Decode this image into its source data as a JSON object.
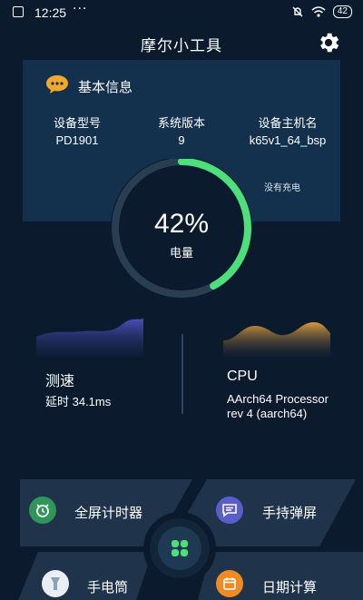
{
  "status_bar": {
    "time": "12:25",
    "dots": "···",
    "battery": "42"
  },
  "app": {
    "title": "摩尔小工具"
  },
  "info_card": {
    "title": "基本信息",
    "columns": [
      {
        "label": "设备型号",
        "value": "PD1901"
      },
      {
        "label": "系统版本",
        "value": "9"
      },
      {
        "label": "设备主机名",
        "value": "k65v1_64_bsp"
      }
    ]
  },
  "battery": {
    "percent_text": "42%",
    "label": "电量",
    "level": 0.42,
    "charge_status": "没有充电"
  },
  "metrics": {
    "speed": {
      "title": "测速",
      "latency": "延时 34.1ms"
    },
    "cpu": {
      "title": "CPU",
      "line1": "AArch64 Processor",
      "line2": "rev 4 (aarch64)"
    }
  },
  "tools": [
    {
      "label": "全屏计时器",
      "icon": "alarm-clock-icon"
    },
    {
      "label": "手持弹屏",
      "icon": "chat-bubble-icon"
    },
    {
      "label": "手电筒",
      "icon": "flashlight-icon"
    },
    {
      "label": "日期计算",
      "icon": "calendar-icon"
    }
  ],
  "colors": {
    "accent": "#4ddf7a",
    "card": "#13314d",
    "background": "#0b1a2d"
  }
}
